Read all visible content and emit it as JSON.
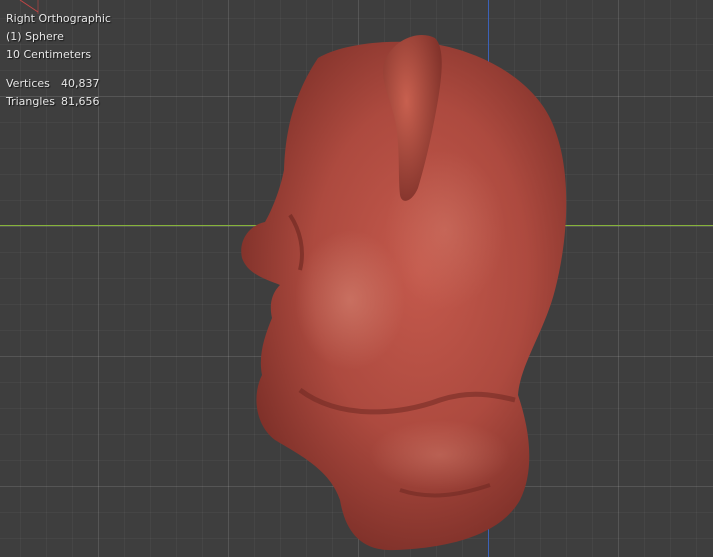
{
  "viewport": {
    "view_name": "Right Orthographic",
    "object_name": "(1) Sphere",
    "grid_scale": "10 Centimeters",
    "stats": [
      {
        "label": "Vertices",
        "value": "40,837"
      },
      {
        "label": "Triangles",
        "value": "81,656"
      }
    ]
  },
  "colors": {
    "background": "#3e3e3e",
    "x_axis": "#86b33a",
    "z_axis": "#3c62b8",
    "mesh": "#b04a3f"
  },
  "icons": {
    "mesh": "sculpted-head-mesh",
    "origin": "origin-marker-icon"
  }
}
